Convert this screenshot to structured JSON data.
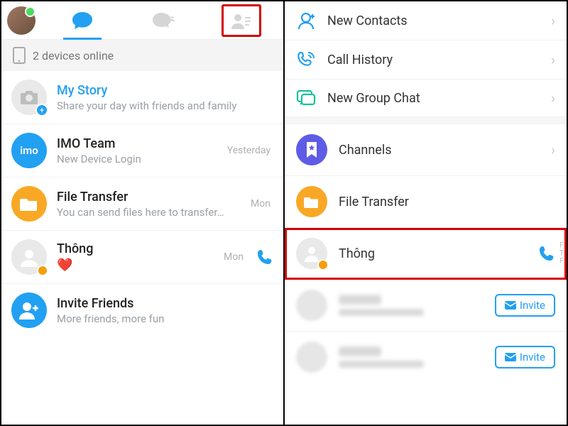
{
  "left": {
    "status": "2 devices online",
    "my_story": {
      "title": "My Story",
      "sub": "Share your day with friends and family"
    },
    "imo_team": {
      "title": "IMO Team",
      "sub": "New Device Login",
      "time": "Yesterday",
      "badge": "imo"
    },
    "file_transfer": {
      "title": "File Transfer",
      "sub": "You can send files here to transfer…",
      "time": "Mon"
    },
    "thong": {
      "title": "Thông",
      "heart": "❤️",
      "time": "Mon"
    },
    "invite": {
      "title": "Invite Friends",
      "sub": "More friends, more fun"
    }
  },
  "right": {
    "new_contacts": "New Contacts",
    "call_history": "Call History",
    "new_group_chat": "New Group Chat",
    "channels": "Channels",
    "file_transfer": "File Transfer",
    "thong": "Thông",
    "invite_label": "Invite",
    "scroll_letters": "F\nT\nF"
  }
}
